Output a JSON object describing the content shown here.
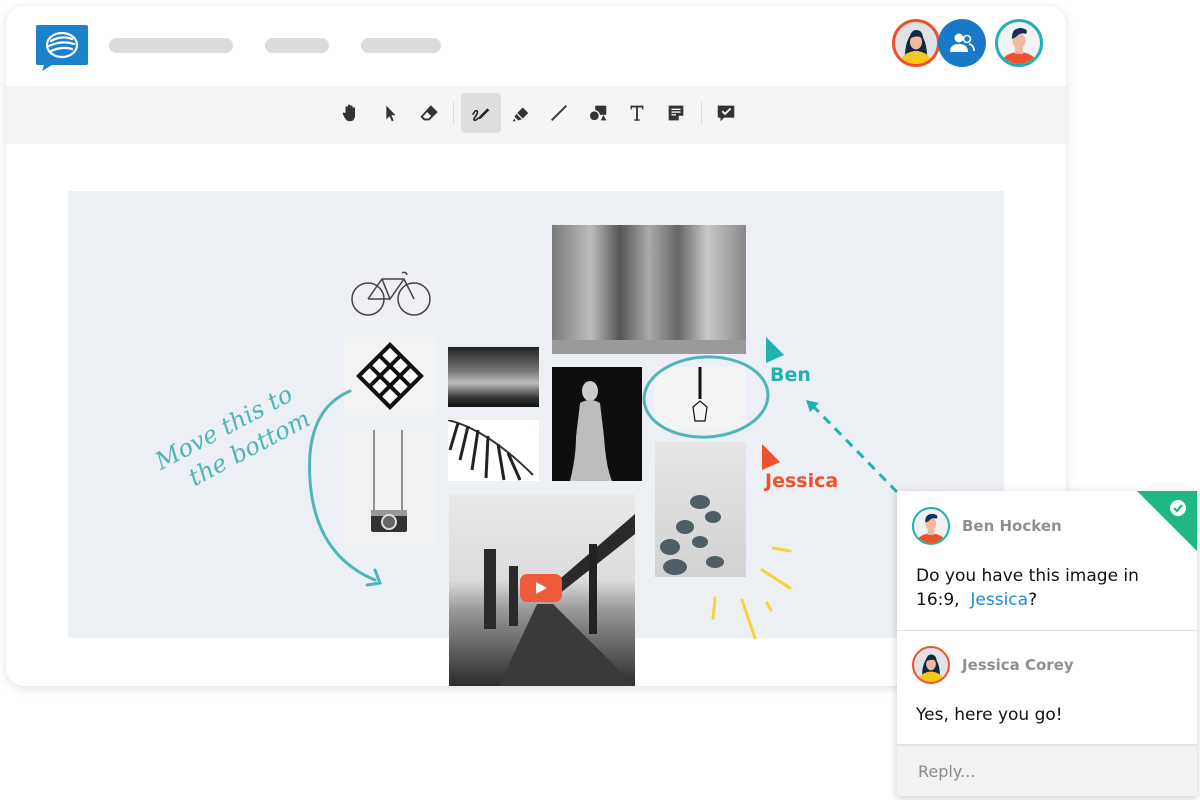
{
  "app": {
    "logo_icon": "chat-bubble-logo-icon",
    "brand_color": "#1a82cc",
    "nav_placeholders": 3
  },
  "participants": [
    {
      "name": "Jessica",
      "icon": "avatar-woman-icon",
      "ring_color": "#f0512d"
    },
    {
      "name": "Group",
      "icon": "group-users-icon",
      "bg_color": "#1a78c8"
    },
    {
      "name": "Ben",
      "icon": "avatar-man-icon",
      "ring_color": "#1fb2b0"
    }
  ],
  "toolbar": {
    "tools": [
      {
        "id": "pan",
        "icon": "hand-icon",
        "active": false
      },
      {
        "id": "select",
        "icon": "pointer-icon",
        "active": false
      },
      {
        "id": "erase",
        "icon": "eraser-icon",
        "active": false
      },
      {
        "id": "draw",
        "icon": "pen-draw-icon",
        "active": true
      },
      {
        "id": "highlight",
        "icon": "highlighter-icon",
        "active": false
      },
      {
        "id": "line",
        "icon": "line-icon",
        "active": false
      },
      {
        "id": "shapes",
        "icon": "shapes-icon",
        "active": false
      },
      {
        "id": "text",
        "icon": "text-icon",
        "active": false
      },
      {
        "id": "note",
        "icon": "sticky-note-icon",
        "active": false
      },
      {
        "id": "comment",
        "icon": "comment-check-icon",
        "active": false
      }
    ]
  },
  "canvas": {
    "annotation_text_line1": "Move this to",
    "annotation_text_line2": "the bottom",
    "annotation_color": "#4fb6b8",
    "images": [
      "bicycle",
      "geometric-tile",
      "camera",
      "street-scene",
      "palm-leaves",
      "mural",
      "statue",
      "pendant-lamp",
      "pier-video",
      "leaf-shadow"
    ],
    "cursors": [
      {
        "label": "Ben",
        "color": "#1fb2b0"
      },
      {
        "label": "Jessica",
        "color": "#f0512d"
      }
    ]
  },
  "comment_thread": {
    "resolved": true,
    "resolved_color": "#1fb785",
    "messages": [
      {
        "author": "Ben Hocken",
        "text_before": "Do you have this image in 16:9,  ",
        "mention": "Jessica",
        "text_after": "?"
      },
      {
        "author": "Jessica Corey",
        "text": "Yes, here you go!"
      }
    ],
    "reply_placeholder": "Reply..."
  }
}
